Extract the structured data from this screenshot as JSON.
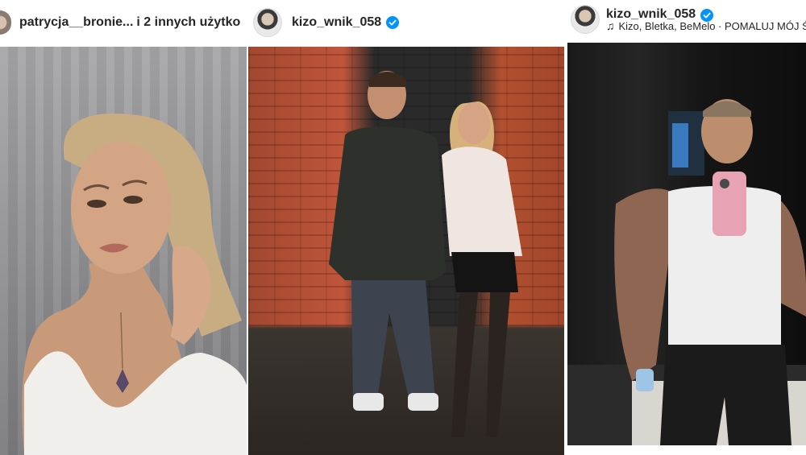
{
  "posts": [
    {
      "username": "patrycja__bronie...",
      "extra": "i 2 innych użytko",
      "photo_icon": "portrait-photo"
    },
    {
      "username": "kizo_wnik_058",
      "verified": true,
      "photo_icon": "couple-photo"
    },
    {
      "username": "kizo_wnik_058",
      "verified": true,
      "music": "Kizo, Bletka, BeMelo · POMALUJ MÓJ ŚW",
      "music_icon": "music-note-icon",
      "photo_icon": "mirror-selfie-photo"
    }
  ],
  "colors": {
    "verified_blue": "#0095f6",
    "text": "#262626"
  }
}
